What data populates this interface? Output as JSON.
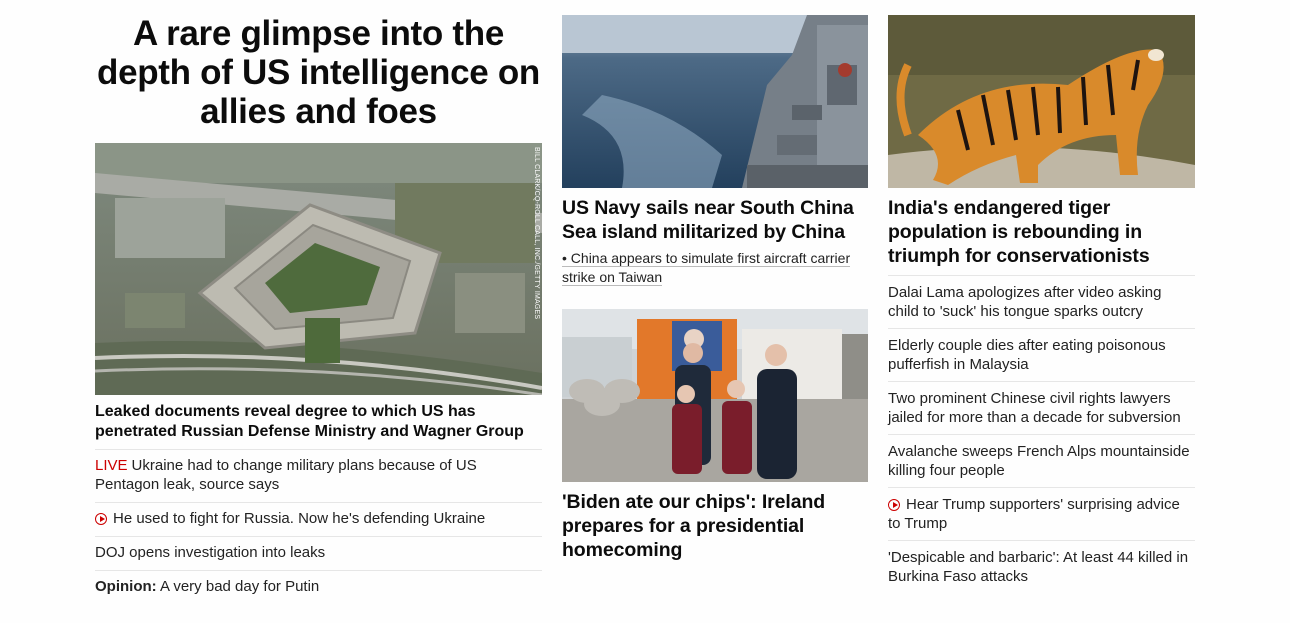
{
  "column1": {
    "headline": "A rare glimpse into the depth of US intelligence on allies and foes",
    "image_credit": "BILL CLARK/CQ-ROLL CALL, INC./GETTY IMAGES",
    "lead_title": "Leaked documents reveal degree to which US has penetrated Russian Defense Ministry and Wagner Group",
    "items": [
      {
        "prefix": "LIVE",
        "text": "Ukraine had to change military plans because of US Pentagon leak, source says"
      },
      {
        "icon": "play-icon",
        "text": "He used to fight for Russia. Now he's defending Ukraine"
      },
      {
        "text": "DOJ opens investigation into leaks"
      },
      {
        "prefix": "Opinion:",
        "text": "A very bad day for Putin"
      }
    ]
  },
  "column2": {
    "story1": {
      "title": "US Navy sails near South China Sea island militarized by China",
      "sub_link": "• China appears to simulate first aircraft carrier strike on Taiwan"
    },
    "story2": {
      "title": "'Biden ate our chips': Ireland prepares for a presidential homecoming"
    }
  },
  "column3": {
    "title": "India's endangered tiger population is rebounding in triumph for conservationists",
    "items": [
      {
        "text": "Dalai Lama apologizes after video asking child to 'suck' his tongue sparks outcry"
      },
      {
        "text": "Elderly couple dies after eating poisonous pufferfish in Malaysia"
      },
      {
        "text": "Two prominent Chinese civil rights lawyers jailed for more than a decade for subversion"
      },
      {
        "text": "Avalanche sweeps French Alps mountainside killing four people"
      },
      {
        "icon": "play-icon",
        "text": "Hear Trump supporters' surprising advice to Trump"
      },
      {
        "text": "'Despicable and barbaric': At least 44 killed in Burkina Faso attacks"
      }
    ]
  },
  "colors": {
    "live_red": "#cc0000",
    "text": "#0c0c0c",
    "divider": "#e6e6e6"
  }
}
